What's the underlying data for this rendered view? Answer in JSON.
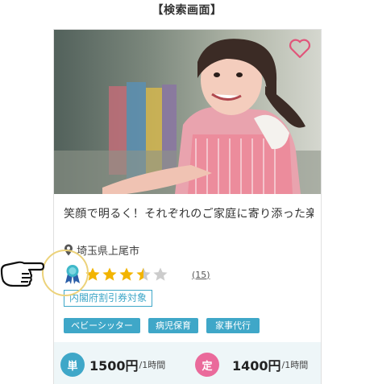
{
  "page_heading": "【検索画面】",
  "card": {
    "title": "笑顔で明るく！それぞれのご家庭に寄り添った楽",
    "location": "埼玉県上尾市",
    "rating": {
      "value": 3.5,
      "max": 5,
      "review_count": "(15)"
    },
    "coupon_label": "内閣府割引券対象",
    "tags": [
      "ベビーシッター",
      "病児保育",
      "家事代行"
    ],
    "prices": [
      {
        "badge": "単",
        "amount": "1500円",
        "unit": "/1時間",
        "color": "#3fa7c8"
      },
      {
        "badge": "定",
        "amount": "1400円",
        "unit": "/1時間",
        "color": "#ea6a9b"
      }
    ]
  },
  "icons": {
    "favorite": "heart-outline-icon",
    "location": "map-pin-icon",
    "badge": "award-ribbon-icon",
    "pointer": "pointing-hand-icon"
  },
  "colors": {
    "accent_blue": "#3fa7c8",
    "accent_pink": "#ea6a9b",
    "heart": "#e0557a",
    "star_filled": "#f2b400",
    "star_empty": "#cccccc",
    "highlight": "#ecd27a",
    "price_bar_bg": "#eef6f8"
  }
}
